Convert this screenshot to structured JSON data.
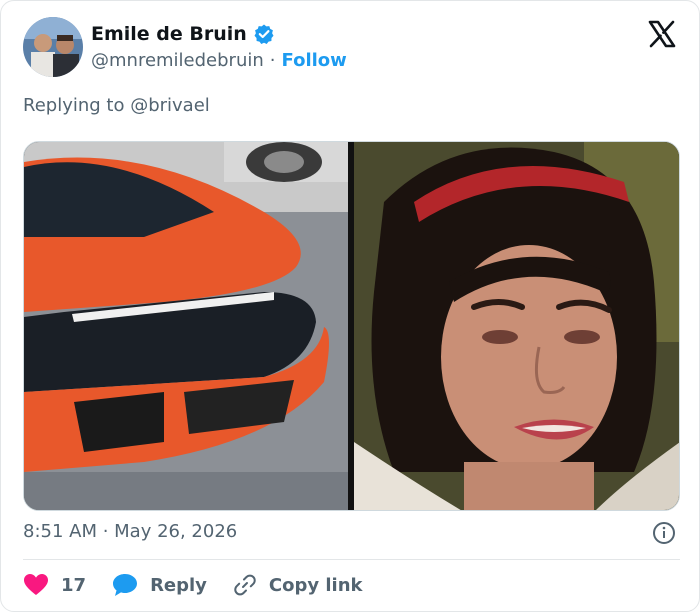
{
  "author": {
    "display_name": "Emile de Bruin",
    "handle": "@mnremiledebruin",
    "separator": "·",
    "follow_label": "Follow"
  },
  "reply_context": "Replying to @brivael",
  "timestamp": "8:51 AM · May 26, 2026",
  "actions": {
    "like_count": "17",
    "reply_label": "Reply",
    "copy_link_label": "Copy link"
  },
  "icons": {
    "verified": "verified-badge-icon",
    "brand": "x-logo-icon",
    "info": "info-icon",
    "like": "heart-icon",
    "reply": "speech-bubble-icon",
    "copy_link": "link-icon"
  },
  "colors": {
    "accent": "#1d9bf0",
    "like": "#f91880",
    "text_primary": "#0f1419",
    "text_secondary": "#536471"
  }
}
